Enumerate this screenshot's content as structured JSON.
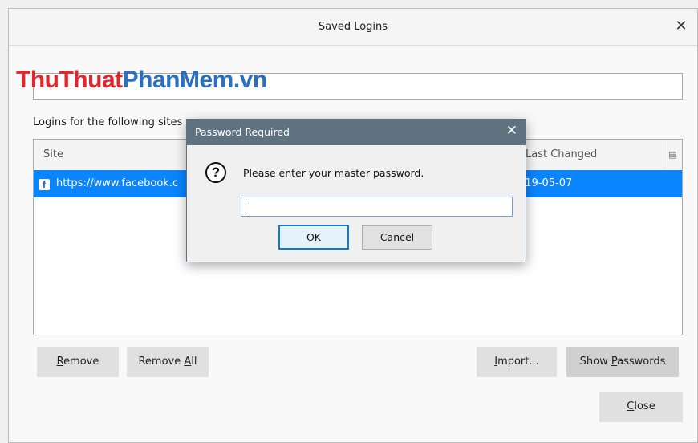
{
  "window": {
    "title": "Saved Logins",
    "close_glyph": "✕"
  },
  "watermark": {
    "part1": "ThuThuat",
    "part2": "PhanMem.vn"
  },
  "search": {
    "value": "",
    "placeholder": ""
  },
  "intro_text": "Logins for the following sites",
  "table": {
    "columns": [
      "Site",
      "Last Changed"
    ],
    "column_picker_icon": "column-picker-icon",
    "rows": [
      {
        "site_icon": "facebook-icon",
        "site": "https://www.facebook.c",
        "last_changed": "019-05-07",
        "selected": true
      }
    ]
  },
  "buttons": {
    "remove": {
      "pre": "",
      "key": "R",
      "post": "emove"
    },
    "remove_all": {
      "pre": "Remove ",
      "key": "A",
      "post": "ll"
    },
    "import": {
      "pre": "",
      "key": "I",
      "post": "mport..."
    },
    "show_passwords": {
      "pre": "Show ",
      "key": "P",
      "post": "asswords"
    },
    "close": {
      "pre": "",
      "key": "C",
      "post": "lose"
    }
  },
  "dialog": {
    "title": "Password Required",
    "close_glyph": "✕",
    "icon": "question-icon",
    "message": "Please enter your master password.",
    "password_value": "",
    "ok_label": "OK",
    "cancel_label": "Cancel"
  },
  "colors": {
    "selection": "#0a84ff",
    "dialog_titlebar": "#5e7280",
    "watermark_red": "#e2262b",
    "watermark_blue": "#2a6fc0"
  }
}
